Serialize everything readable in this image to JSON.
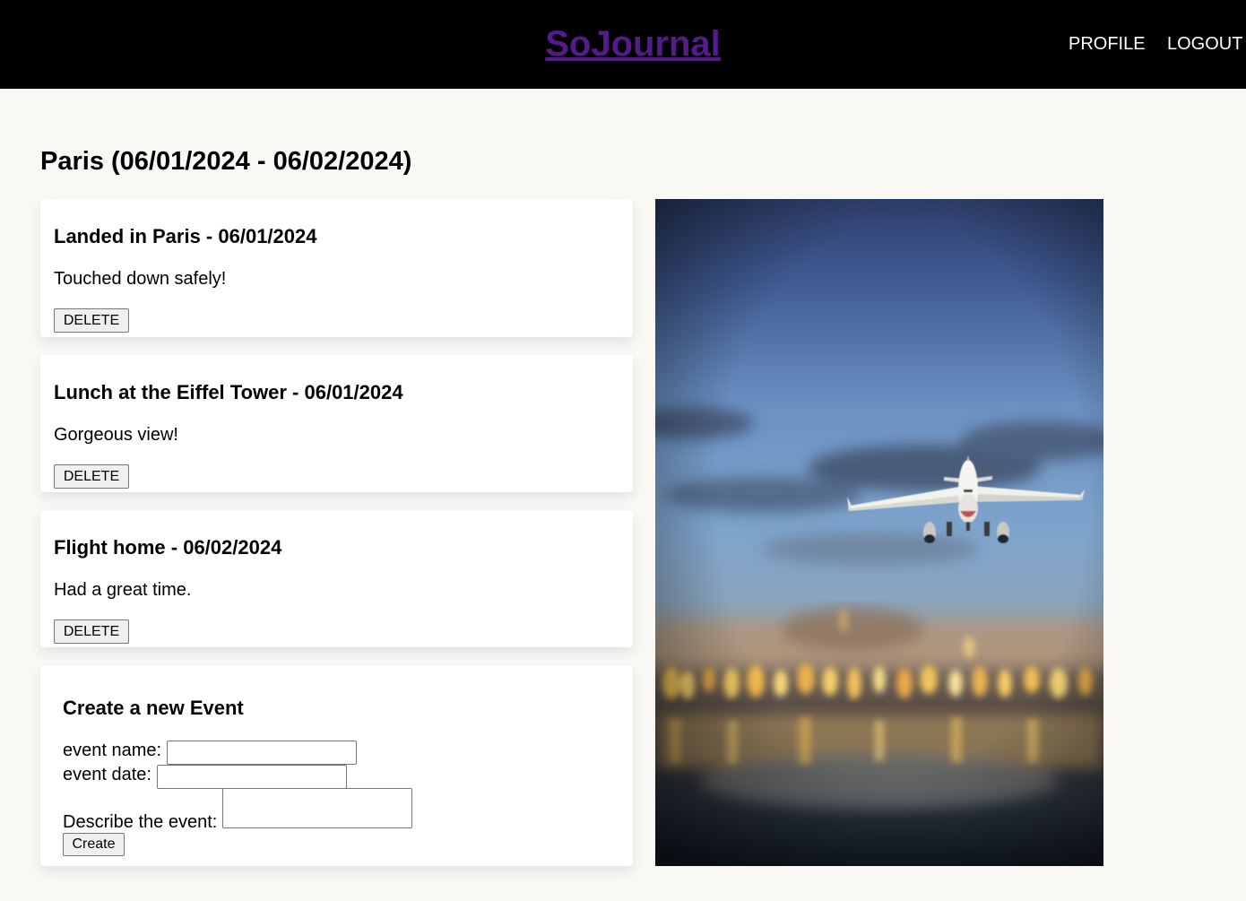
{
  "header": {
    "brand": "SoJournal",
    "nav": [
      "PROFILE",
      "LOGOUT"
    ]
  },
  "trip": {
    "title": "Paris (06/01/2024 - 06/02/2024)"
  },
  "events": [
    {
      "title": "Landed in Paris - 06/01/2024",
      "description": "Touched down safely!",
      "delete_label": "DELETE"
    },
    {
      "title": "Lunch at the Eiffel Tower - 06/01/2024",
      "description": "Gorgeous view!",
      "delete_label": "DELETE"
    },
    {
      "title": "Flight home - 06/02/2024",
      "description": "Had a great time.",
      "delete_label": "DELETE"
    }
  ],
  "create_form": {
    "heading": "Create a new Event",
    "name_label": "event name:",
    "name_value": "",
    "date_label": "event date:",
    "date_value": "",
    "describe_label": "Describe the event:",
    "describe_value": "",
    "submit_label": "Create"
  },
  "colors": {
    "header_bg": "#000000",
    "brand_link": "#551a8b",
    "page_bg": "#f9f8f5"
  }
}
